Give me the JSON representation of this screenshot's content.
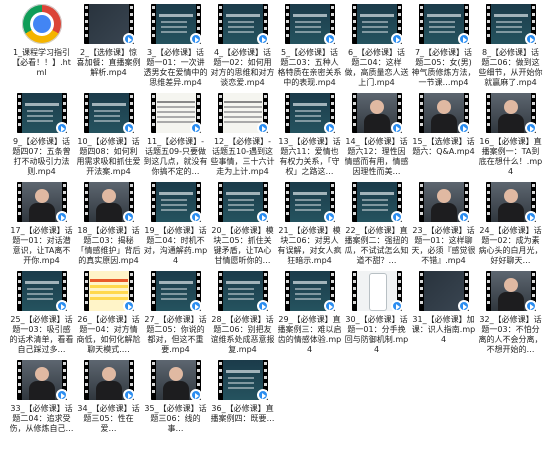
{
  "folder": {
    "items": [
      {
        "label": "1_课程学习指引【必看！！】.html",
        "kind": "html"
      },
      {
        "label": "2_【选修课】惊喜加餐：直播案例解析.mp4",
        "kind": "video",
        "thumb": "dark"
      },
      {
        "label": "3_【必修课】话题一01：一次讲透男女在爱情中的思维差异.mp4",
        "kind": "video",
        "thumb": "slide"
      },
      {
        "label": "4_【必修课】话题一02：如何用对方的思维和对方谈恋爱.mp4",
        "kind": "video",
        "thumb": "slide"
      },
      {
        "label": "5_【必修课】话题二03：五种人格特质在亲密关系中的表现.mp4",
        "kind": "video",
        "thumb": "slide"
      },
      {
        "label": "6_【必修课】话题二04：这样做，高质量恋人送上门.mp4",
        "kind": "video",
        "thumb": "slide"
      },
      {
        "label": "7_【必修课】话题二05：女(男)神气质修炼方法，一节课…mp4",
        "kind": "video",
        "thumb": "slide"
      },
      {
        "label": "8_【必修课】话题二06：做到这些细节，从开始你就赢麻了.mp4",
        "kind": "video",
        "thumb": "slide"
      },
      {
        "label": "9_【必修课】话题四07：五条曾打不动吸引力法则.mp4",
        "kind": "video",
        "thumb": "slide"
      },
      {
        "label": "10_【必修课】话题四08：如何利用需求吸和抓住爱开法案.mp4",
        "kind": "video",
        "thumb": "slide"
      },
      {
        "label": "11_【必修课】-话题五09-只要做到这几点，就没有你搞不定的…",
        "kind": "video",
        "thumb": "light"
      },
      {
        "label": "12_【必修课】-话题五10-遇到这些事情，三十六计走为上计.mp4",
        "kind": "video",
        "thumb": "light"
      },
      {
        "label": "13_【必修课】话题六11：爱情也有权力关系，「守权」之路这…",
        "kind": "video",
        "thumb": "slide"
      },
      {
        "label": "14_【必修课】话题六12：理性因情感而有用，情感因理性而美…",
        "kind": "video",
        "thumb": "person"
      },
      {
        "label": "15_【选修课】话题六：Q&A.mp4",
        "kind": "video",
        "thumb": "person"
      },
      {
        "label": "16_【必修课】直播案例一：TA到底在想什么！.mp4",
        "kind": "video",
        "thumb": "person"
      },
      {
        "label": "17_【必修课】话题一01：对话潜意识，让TA离不开你.mp4",
        "kind": "video",
        "thumb": "person"
      },
      {
        "label": "18_【必修课】话题二03：揭秘「情感维护」背后的真实原因.mp4",
        "kind": "video",
        "thumb": "person"
      },
      {
        "label": "19_【必修课】话题二04：时机不对，沟通解药.mp4",
        "kind": "video",
        "thumb": "slide"
      },
      {
        "label": "20_【必修课】模块二05：抓住关键矛盾，让TA心甘情愿听你的…",
        "kind": "video",
        "thumb": "slide"
      },
      {
        "label": "21_【必修课】模块二06：对男人有误解，对女人疯狂暗示.mp4",
        "kind": "video",
        "thumb": "slide"
      },
      {
        "label": "22_【必修课】直播案例二：强扭的瓜，不试试怎么知道不甜？…",
        "kind": "video",
        "thumb": "slide"
      },
      {
        "label": "23_【必修课】话题一01：这样聊天，必须『感觉很不错』.mp4",
        "kind": "video",
        "thumb": "person"
      },
      {
        "label": "24_【必修课】话题一02：成为素病心头的白月光，好好聊天…",
        "kind": "video",
        "thumb": "person"
      },
      {
        "label": "25_【必修课】话题一03：吸引感的话术清单，看看自己踩过多…",
        "kind": "video",
        "thumb": "slide"
      },
      {
        "label": "26_【必修课】话题一04：对方情商低，如何化解尬聊天模式.…",
        "kind": "video",
        "thumb": "yellow"
      },
      {
        "label": "27_【必修课】话题二05：你说的都对，但这不重要.mp4",
        "kind": "video",
        "thumb": "slide"
      },
      {
        "label": "28_【必修课】话题二06：别把友谊维系处成恶意报复.mp4",
        "kind": "video",
        "thumb": "slide"
      },
      {
        "label": "29_【必修课】直播案例三：难以启齿的情感体验.mp4",
        "kind": "video",
        "thumb": "slide"
      },
      {
        "label": "30_【必修课】话题一01：分手挽回与防御机制.mp4",
        "kind": "video",
        "thumb": "phone"
      },
      {
        "label": "31_【必修课】加课：识人指南.mp4",
        "kind": "video",
        "thumb": "dark"
      },
      {
        "label": "32_【必修课】话题一03：不怕分离的人不会分离，不想开始的…",
        "kind": "video",
        "thumb": "person"
      },
      {
        "label": "33_【必修课】话题二04：追求受伤，从修炼自己…",
        "kind": "video",
        "thumb": "person"
      },
      {
        "label": "34_【必修课】话题三05：性在爱…",
        "kind": "video",
        "thumb": "person"
      },
      {
        "label": "35_【必修课】话题三06：线的事…",
        "kind": "video",
        "thumb": "person"
      },
      {
        "label": "36_【必修课】直播案例四：既要…",
        "kind": "video",
        "thumb": "slide"
      }
    ]
  }
}
